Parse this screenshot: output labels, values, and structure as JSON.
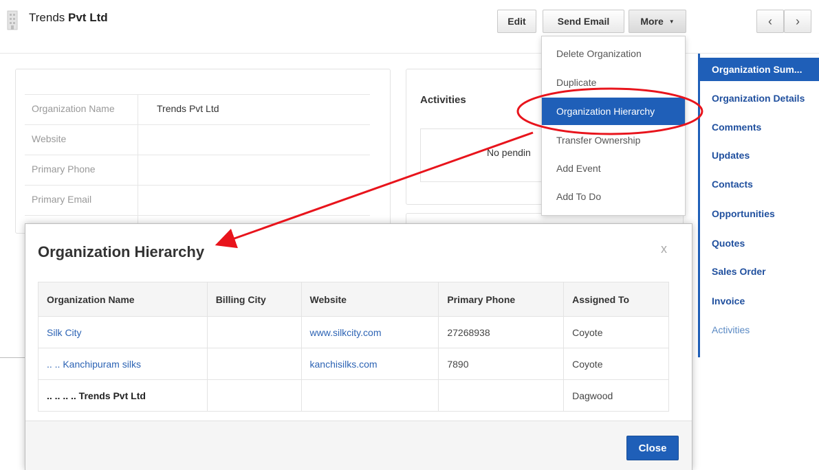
{
  "header": {
    "title_first": "Trends",
    "title_rest": "Pvt Ltd",
    "edit_label": "Edit",
    "send_email_label": "Send Email",
    "more_label": "More",
    "prev_icon": "‹",
    "next_icon": "›"
  },
  "more_menu": {
    "items": [
      {
        "label": "Delete Organization",
        "active": false
      },
      {
        "label": "Duplicate",
        "active": false
      },
      {
        "label": "Organization Hierarchy",
        "active": true
      },
      {
        "label": "Transfer Ownership",
        "active": false
      },
      {
        "label": "Add Event",
        "active": false
      },
      {
        "label": "Add To Do",
        "active": false
      }
    ]
  },
  "detail": {
    "fields": [
      {
        "label": "Organization Name",
        "value": "Trends Pvt Ltd"
      },
      {
        "label": "Website",
        "value": ""
      },
      {
        "label": "Primary Phone",
        "value": ""
      },
      {
        "label": "Primary Email",
        "value": ""
      },
      {
        "label": "Assigned To",
        "value": "Dagwood"
      }
    ]
  },
  "activities": {
    "title": "Activities",
    "empty_text": "No pendin"
  },
  "rightnav": {
    "items": [
      {
        "label": "Organization Sum...",
        "state": "active"
      },
      {
        "label": "Organization Details",
        "state": "normal"
      },
      {
        "label": "Comments",
        "state": "normal"
      },
      {
        "label": "Updates",
        "state": "normal"
      },
      {
        "label": "Contacts",
        "state": "normal"
      },
      {
        "label": "Opportunities",
        "state": "normal"
      },
      {
        "label": "Quotes",
        "state": "normal"
      },
      {
        "label": "Sales Order",
        "state": "normal"
      },
      {
        "label": "Invoice",
        "state": "normal"
      },
      {
        "label": "Activities",
        "state": "muted"
      }
    ]
  },
  "modal": {
    "title": "Organization Hierarchy",
    "close_x": "x",
    "columns": [
      "Organization Name",
      "Billing City",
      "Website",
      "Primary Phone",
      "Assigned To"
    ],
    "rows": [
      {
        "name": "Silk City",
        "city": "",
        "website": "www.silkcity.com",
        "phone": "27268938",
        "assigned": "Coyote",
        "link": true
      },
      {
        "name": ".. .. Kanchipuram silks",
        "city": "",
        "website": "kanchisilks.com",
        "phone": "7890",
        "assigned": "Coyote",
        "link": true
      },
      {
        "name": ".. .. .. .. Trends Pvt Ltd",
        "city": "",
        "website": "",
        "phone": "",
        "assigned": "Dagwood",
        "link": false
      }
    ],
    "close_label": "Close"
  },
  "colors": {
    "accent": "#1f5fb8",
    "link": "#2c63b4",
    "annotation_red": "#e8141c"
  }
}
